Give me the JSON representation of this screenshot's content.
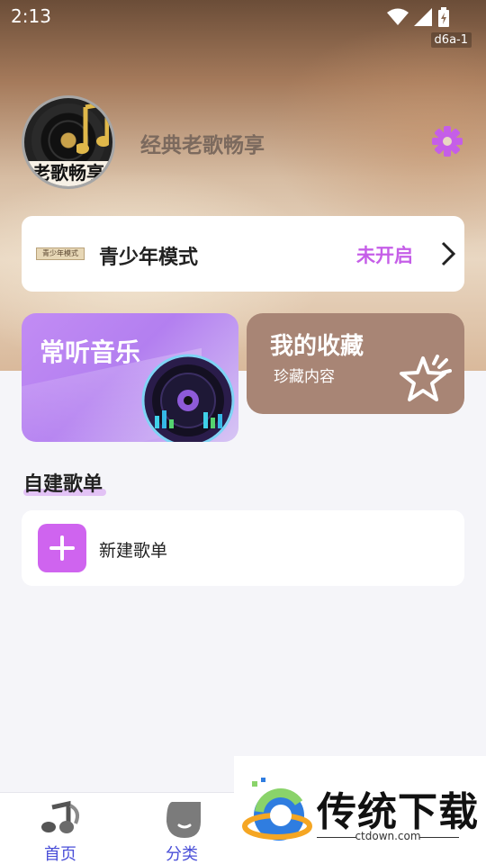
{
  "status_bar": {
    "time": "2:13",
    "build_tag": "d6a-1"
  },
  "profile": {
    "avatar_caption": "老歌畅享",
    "app_name": "经典老歌畅享"
  },
  "youth_mode": {
    "thumb_text": "青少年模式",
    "label": "青少年模式",
    "state": "未开启"
  },
  "cards": {
    "often": {
      "title": "常听音乐"
    },
    "favorites": {
      "title": "我的收藏",
      "subtitle": "珍藏内容"
    }
  },
  "playlists": {
    "section_title": "自建歌单",
    "new_label": "新建歌单"
  },
  "tabbar": {
    "tabs": [
      {
        "label": "首页"
      },
      {
        "label": "分类"
      }
    ]
  },
  "watermark": {
    "brand": "传统下载",
    "url": "ctdown.com"
  },
  "colors": {
    "accent": "#c55ee8",
    "tab_text": "#4a4fd8",
    "fav_card": "#a88575"
  }
}
